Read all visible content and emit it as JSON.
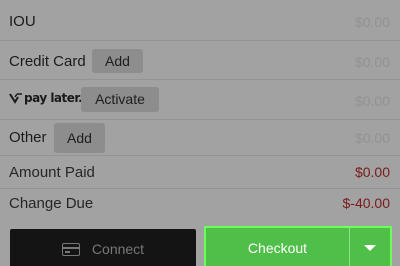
{
  "payments": {
    "iou": {
      "label": "IOU",
      "amount": "$0.00"
    },
    "credit_card": {
      "label": "Credit Card",
      "button": "Add",
      "amount": "$0.00"
    },
    "paylater": {
      "brand": "pay later.",
      "button": "Activate",
      "amount": "$0.00"
    },
    "other": {
      "label": "Other",
      "button": "Add",
      "amount": "$0.00"
    }
  },
  "summary": {
    "amount_paid_label": "Amount Paid",
    "amount_paid_value": "$0.00",
    "change_due_label": "Change Due",
    "change_due_value": "$-40.00"
  },
  "actions": {
    "connect_label": "Connect",
    "checkout_label": "Checkout"
  },
  "colors": {
    "accent_green": "#4fbf49",
    "negative_red": "#7a1b1b"
  },
  "icons": {
    "card": "credit-card-icon",
    "caret": "chevron-down-icon",
    "paylater_logo": "v-check-logo-icon"
  }
}
